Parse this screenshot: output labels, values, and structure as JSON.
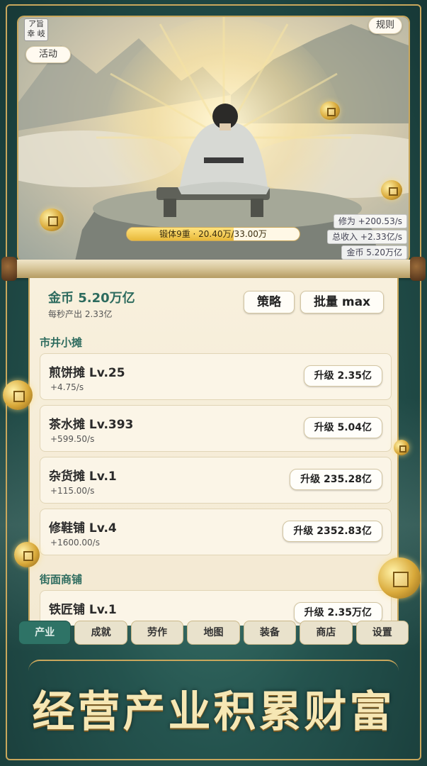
{
  "header": {
    "logo_text": "ア旨幸 岐",
    "rules_label": "规则",
    "activity_label": "活动"
  },
  "scene": {
    "progress_label": "锻体9重 · 20.40万/33.00万",
    "progress_fraction": 0.618,
    "stats": {
      "cultivation": "修为 +200.53/s",
      "income": "总收入 +2.33亿/s",
      "gold": "金币 5.20万亿"
    }
  },
  "panel": {
    "coins_title": "金币 5.20万亿",
    "coins_sub": "每秒产出 2.33亿",
    "strategy_label": "策略",
    "batch_label": "批量 max",
    "sections": [
      {
        "label": "市井小摊",
        "items": [
          {
            "name": "煎饼摊 Lv.25",
            "rate": "+4.75/s",
            "upgrade": "升级 2.35亿"
          },
          {
            "name": "茶水摊 Lv.393",
            "rate": "+599.50/s",
            "upgrade": "升级 5.04亿"
          },
          {
            "name": "杂货摊 Lv.1",
            "rate": "+115.00/s",
            "upgrade": "升级 235.28亿"
          },
          {
            "name": "修鞋铺 Lv.4",
            "rate": "+1600.00/s",
            "upgrade": "升级 2352.83亿"
          }
        ]
      },
      {
        "label": "街面商铺",
        "items": [
          {
            "name": "铁匠铺 Lv.1",
            "rate": "",
            "upgrade": "升级 2.35万亿"
          }
        ]
      }
    ]
  },
  "nav": {
    "tabs": [
      "产业",
      "成就",
      "劳作",
      "地图",
      "装备",
      "商店",
      "设置"
    ],
    "active_index": 0
  },
  "slogan": "经营产业积累财富",
  "colors": {
    "accent_green": "#2e7366",
    "gold": "#c9a75c",
    "paper": "#f6eed9"
  }
}
